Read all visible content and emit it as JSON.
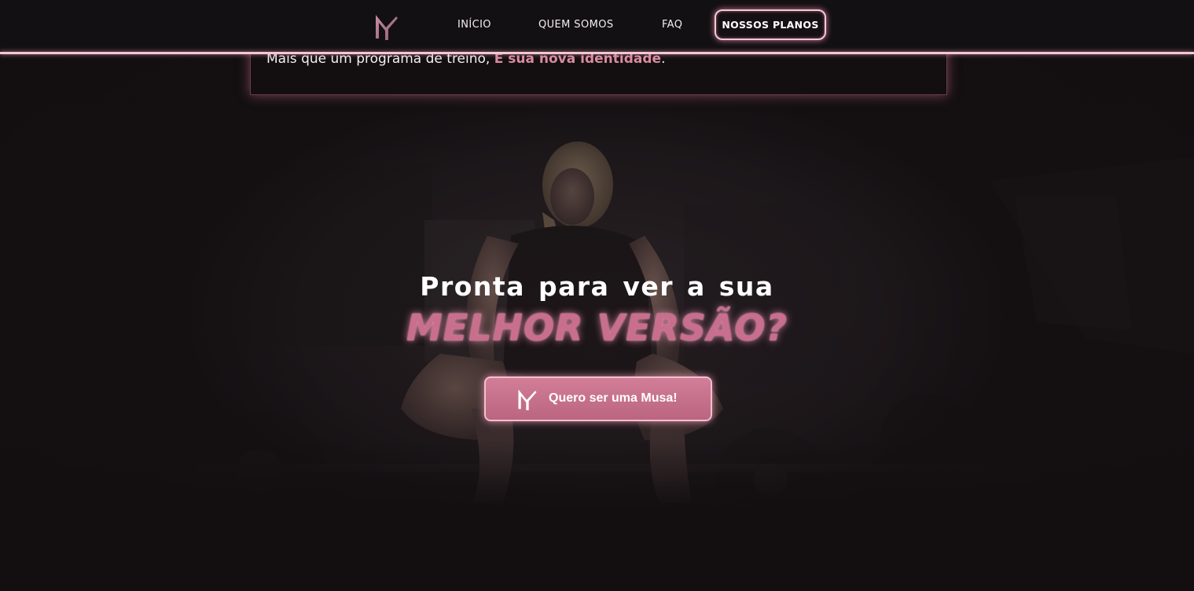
{
  "nav": {
    "logo_icon": "musa-logo-icon",
    "links": [
      {
        "label": "INÍCIO"
      },
      {
        "label": "QUEM SOMOS"
      },
      {
        "label": "FAQ"
      }
    ],
    "plans_button": "NOSSOS PLANOS"
  },
  "info_card": {
    "text": "Mais que um programa de treino, ",
    "highlight": "É sua nova identidade",
    "suffix": "."
  },
  "hero": {
    "headline": "Pronta para ver a sua",
    "accent": "MELHOR VERSÃO?",
    "cta_label": "Quero ser uma Musa!",
    "cta_icon": "musa-logo-icon"
  },
  "colors": {
    "background": "#130f11",
    "accent_pink": "#d88ba1",
    "button_pink": "#c96e8c",
    "glow": "#f2c7d3"
  }
}
